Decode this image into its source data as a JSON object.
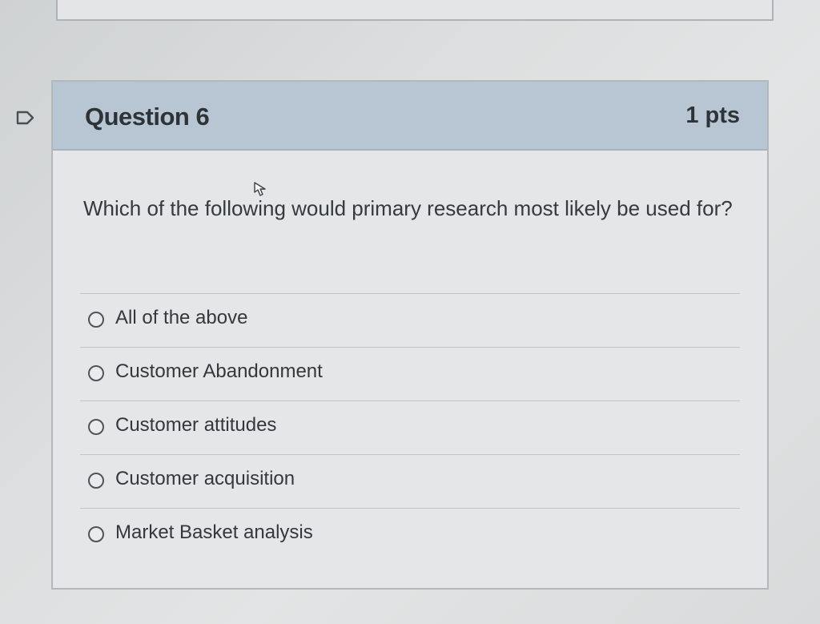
{
  "question": {
    "title": "Question 6",
    "points": "1 pts",
    "text": "Which of the following would primary research most likely be used for?",
    "answers": [
      {
        "label": "All of the above",
        "selected": false
      },
      {
        "label": "Customer Abandonment",
        "selected": false
      },
      {
        "label": "Customer attitudes",
        "selected": false
      },
      {
        "label": "Customer acquisition",
        "selected": false
      },
      {
        "label": "Market Basket analysis",
        "selected": false
      }
    ]
  },
  "icons": {
    "flag": "flag-icon",
    "cursor": "mouse-cursor-icon"
  },
  "colors": {
    "header_bg": "#b8c6d4",
    "body_bg": "#e4e6e7",
    "text": "#33383d"
  }
}
